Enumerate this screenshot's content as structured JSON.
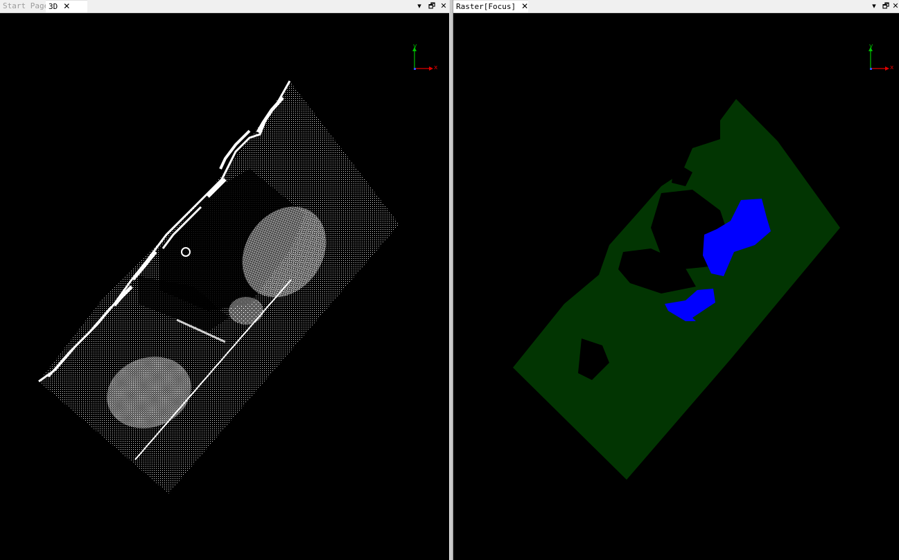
{
  "left_pane": {
    "tabs": [
      {
        "label": "Start Page",
        "state": "inactive"
      },
      {
        "label": "3D",
        "state": "active"
      }
    ],
    "controls": {
      "menu": "▾",
      "restore": "🗗",
      "close": "✕"
    }
  },
  "right_pane": {
    "tabs": [
      {
        "label": "Raster[Focus]",
        "state": "active"
      }
    ],
    "controls": {
      "menu": "▾",
      "restore": "🗗",
      "close": "✕"
    }
  },
  "axis_gizmo": {
    "y_label": "y",
    "x_label": "x",
    "y_color": "#00c000",
    "x_color": "#e00000",
    "origin_color": "#3050ff"
  },
  "raster_colors": {
    "ground": "#023502",
    "highlight": "#0000ff"
  },
  "point_cloud_color": "#ffffff"
}
